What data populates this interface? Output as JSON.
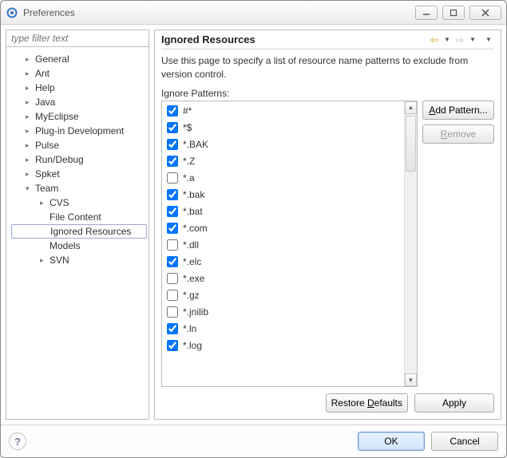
{
  "window": {
    "title": "Preferences"
  },
  "filter": {
    "placeholder": "type filter text"
  },
  "tree": {
    "items": [
      {
        "label": "General",
        "level": 1,
        "expandable": true
      },
      {
        "label": "Ant",
        "level": 1,
        "expandable": true
      },
      {
        "label": "Help",
        "level": 1,
        "expandable": true
      },
      {
        "label": "Java",
        "level": 1,
        "expandable": true
      },
      {
        "label": "MyEclipse",
        "level": 1,
        "expandable": true
      },
      {
        "label": "Plug-in Development",
        "level": 1,
        "expandable": true
      },
      {
        "label": "Pulse",
        "level": 1,
        "expandable": true
      },
      {
        "label": "Run/Debug",
        "level": 1,
        "expandable": true
      },
      {
        "label": "Spket",
        "level": 1,
        "expandable": true
      },
      {
        "label": "Team",
        "level": 1,
        "expandable": true,
        "expanded": true
      },
      {
        "label": "CVS",
        "level": 2,
        "expandable": true
      },
      {
        "label": "File Content",
        "level": 2,
        "expandable": false
      },
      {
        "label": "Ignored Resources",
        "level": 2,
        "expandable": false,
        "selected": true
      },
      {
        "label": "Models",
        "level": 2,
        "expandable": false
      },
      {
        "label": "SVN",
        "level": 2,
        "expandable": true
      }
    ]
  },
  "page": {
    "heading": "Ignored Resources",
    "description": "Use this page to specify a list of resource name patterns to exclude from version control.",
    "list_label": "Ignore Patterns:"
  },
  "patterns": [
    {
      "label": "#*",
      "checked": true
    },
    {
      "label": "*$",
      "checked": true
    },
    {
      "label": "*.BAK",
      "checked": true
    },
    {
      "label": "*.Z",
      "checked": true
    },
    {
      "label": "*.a",
      "checked": false
    },
    {
      "label": "*.bak",
      "checked": true
    },
    {
      "label": "*.bat",
      "checked": true
    },
    {
      "label": "*.com",
      "checked": true
    },
    {
      "label": "*.dll",
      "checked": false
    },
    {
      "label": "*.elc",
      "checked": true
    },
    {
      "label": "*.exe",
      "checked": false
    },
    {
      "label": "*.gz",
      "checked": false
    },
    {
      "label": "*.jnilib",
      "checked": false
    },
    {
      "label": "*.ln",
      "checked": true
    },
    {
      "label": "*.log",
      "checked": true
    }
  ],
  "buttons": {
    "add_pattern": "Add Pattern...",
    "remove": "Remove",
    "restore_defaults": "Restore Defaults",
    "apply": "Apply",
    "ok": "OK",
    "cancel": "Cancel"
  }
}
